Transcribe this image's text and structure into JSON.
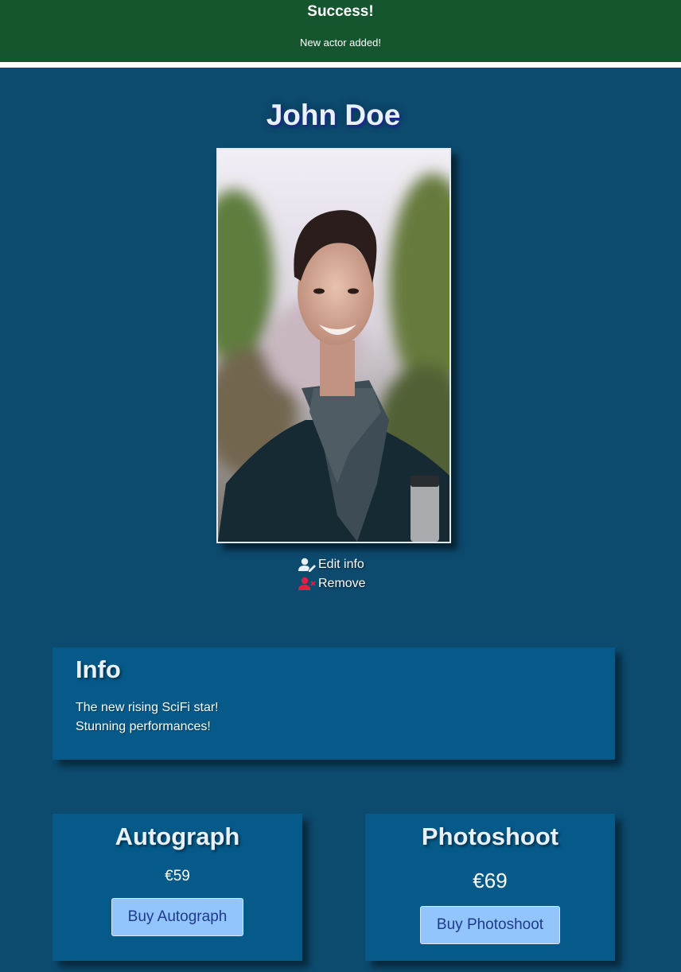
{
  "alert": {
    "title": "Success!",
    "message": "New actor added!",
    "color": "#16562f"
  },
  "actor": {
    "name": "John Doe",
    "photo_alt": "Portrait of John Doe"
  },
  "actions": {
    "edit_label": "Edit info",
    "edit_icon": "user-edit-icon",
    "remove_label": "Remove",
    "remove_icon": "user-remove-icon",
    "remove_color": "#e11d48"
  },
  "info": {
    "heading": "Info",
    "lines": [
      "The new rising SciFi star!",
      "Stunning performances!"
    ]
  },
  "products": [
    {
      "name": "Autograph",
      "price": "€59",
      "button_label": "Buy Autograph"
    },
    {
      "name": "Photoshoot",
      "price": "€69",
      "button_label": "Buy Photoshoot"
    }
  ],
  "colors": {
    "background": "#0c4a6e",
    "card": "#055a89",
    "button": "#93c5fd",
    "button_text": "#1e3a8a"
  }
}
